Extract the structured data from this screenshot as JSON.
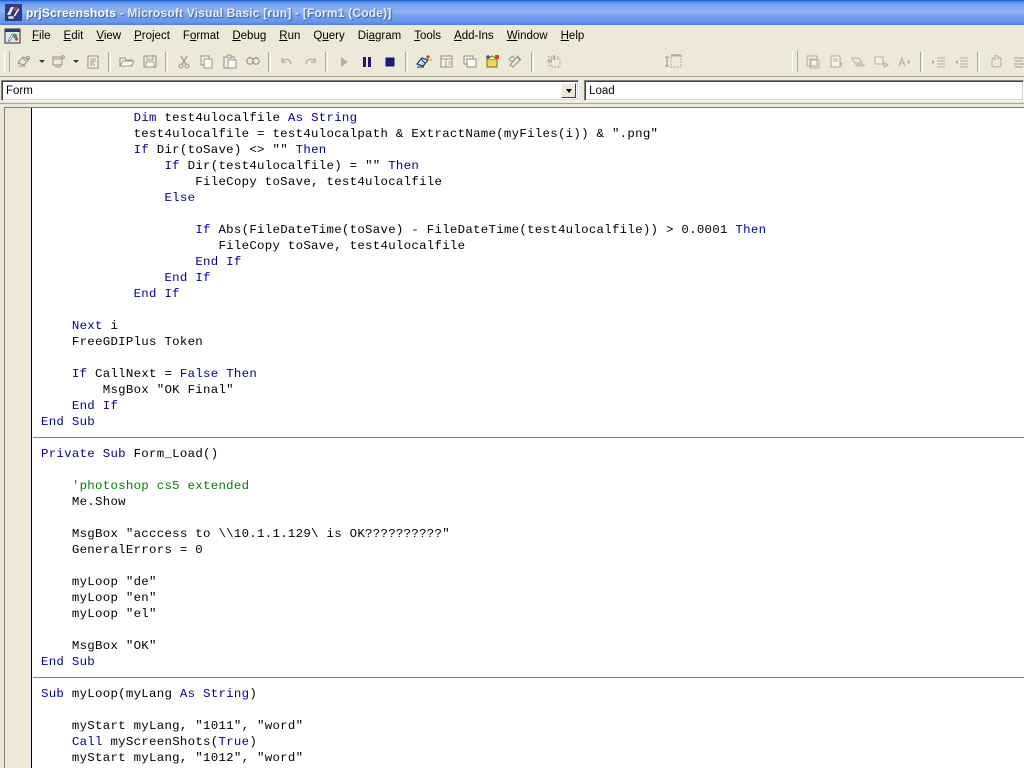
{
  "window": {
    "title_project": "prjScreenshots",
    "title_rest": " - Microsoft Visual Basic [run] - [Form1 (Code)]",
    "app_icon": "vb-project-icon",
    "system_icon": "vb-form-icon"
  },
  "menubar": {
    "items": [
      {
        "label": "File",
        "accel": "F"
      },
      {
        "label": "Edit",
        "accel": "E"
      },
      {
        "label": "View",
        "accel": "V"
      },
      {
        "label": "Project",
        "accel": "P"
      },
      {
        "label": "Format",
        "accel": "o"
      },
      {
        "label": "Debug",
        "accel": "D"
      },
      {
        "label": "Run",
        "accel": "R"
      },
      {
        "label": "Query",
        "accel": "u"
      },
      {
        "label": "Diagram",
        "accel": "a"
      },
      {
        "label": "Tools",
        "accel": "T"
      },
      {
        "label": "Add-Ins",
        "accel": "A"
      },
      {
        "label": "Window",
        "accel": "W"
      },
      {
        "label": "Help",
        "accel": "H"
      }
    ]
  },
  "toolbar": {
    "buttons": [
      {
        "name": "add-standard-exe-icon",
        "enabled": false,
        "dropdown": true
      },
      {
        "name": "add-form-icon",
        "enabled": false,
        "dropdown": true
      },
      {
        "name": "menu-editor-icon",
        "enabled": false,
        "dropdown": false
      },
      {
        "name": "open-project-icon",
        "enabled": false,
        "dropdown": false
      },
      {
        "name": "save-project-icon",
        "enabled": false,
        "dropdown": false
      },
      {
        "name": "cut-icon",
        "enabled": false,
        "dropdown": false
      },
      {
        "name": "copy-icon",
        "enabled": false,
        "dropdown": false
      },
      {
        "name": "paste-icon",
        "enabled": false,
        "dropdown": false
      },
      {
        "name": "find-icon",
        "enabled": false,
        "dropdown": false
      },
      {
        "name": "undo-icon",
        "enabled": false,
        "dropdown": false
      },
      {
        "name": "redo-icon",
        "enabled": false,
        "dropdown": false
      },
      {
        "name": "start-run-icon",
        "enabled": false,
        "dropdown": false
      },
      {
        "name": "break-pause-icon",
        "enabled": true,
        "dropdown": false
      },
      {
        "name": "end-stop-icon",
        "enabled": true,
        "dropdown": false
      },
      {
        "name": "project-explorer-icon",
        "enabled": true,
        "dropdown": false
      },
      {
        "name": "properties-window-icon",
        "enabled": false,
        "dropdown": false
      },
      {
        "name": "form-layout-icon",
        "enabled": false,
        "dropdown": false
      },
      {
        "name": "object-browser-icon",
        "enabled": true,
        "dropdown": false
      },
      {
        "name": "toolbox-icon",
        "enabled": false,
        "dropdown": false
      },
      {
        "name": "form-position-indicator",
        "enabled": false,
        "dropdown": false
      },
      {
        "name": "form-size-indicator",
        "enabled": false,
        "dropdown": false,
        "text": ""
      }
    ],
    "right_group": [
      {
        "name": "data-view-window-icon",
        "enabled": false
      },
      {
        "name": "visual-component-mgr-icon",
        "enabled": false
      },
      {
        "name": "sql-query-builder-icon",
        "enabled": false
      },
      {
        "name": "database-designer-icon",
        "enabled": false
      },
      {
        "name": "font-size-icon",
        "enabled": false
      },
      {
        "name": "indent-increase-icon",
        "enabled": false
      },
      {
        "name": "indent-decrease-icon",
        "enabled": false
      },
      {
        "name": "hand-pan-icon",
        "enabled": false
      },
      {
        "name": "align-list-icon",
        "enabled": false
      },
      {
        "name": "center-list-icon",
        "enabled": false
      }
    ]
  },
  "code_editor": {
    "object_combo": {
      "value": "Form"
    },
    "procedure_combo": {
      "value": "Load"
    },
    "lines": [
      {
        "segments": [
          {
            "t": "            ",
            "c": "pl"
          },
          {
            "t": "Dim",
            "c": "kw"
          },
          {
            "t": " test4ulocalfile ",
            "c": "pl"
          },
          {
            "t": "As String",
            "c": "kw"
          }
        ]
      },
      {
        "segments": [
          {
            "t": "            test4ulocalfile = test4ulocalpath & ExtractName(myFiles(i)) & \".png\"",
            "c": "pl"
          }
        ]
      },
      {
        "segments": [
          {
            "t": "            ",
            "c": "pl"
          },
          {
            "t": "If",
            "c": "kw"
          },
          {
            "t": " Dir(toSave) <> \"\" ",
            "c": "pl"
          },
          {
            "t": "Then",
            "c": "kw"
          }
        ]
      },
      {
        "segments": [
          {
            "t": "                ",
            "c": "pl"
          },
          {
            "t": "If",
            "c": "kw"
          },
          {
            "t": " Dir(test4ulocalfile) = \"\" ",
            "c": "pl"
          },
          {
            "t": "Then",
            "c": "kw"
          }
        ]
      },
      {
        "segments": [
          {
            "t": "                    FileCopy toSave, test4ulocalfile",
            "c": "pl"
          }
        ]
      },
      {
        "segments": [
          {
            "t": "                ",
            "c": "pl"
          },
          {
            "t": "Else",
            "c": "kw"
          }
        ]
      },
      {
        "segments": [
          {
            "t": "",
            "c": "pl"
          }
        ]
      },
      {
        "segments": [
          {
            "t": "                    ",
            "c": "pl"
          },
          {
            "t": "If",
            "c": "kw"
          },
          {
            "t": " Abs(FileDateTime(toSave) - FileDateTime(test4ulocalfile)) > 0.0001 ",
            "c": "pl"
          },
          {
            "t": "Then",
            "c": "kw"
          }
        ]
      },
      {
        "segments": [
          {
            "t": "                       FileCopy toSave, test4ulocalfile",
            "c": "pl"
          }
        ]
      },
      {
        "segments": [
          {
            "t": "                    ",
            "c": "pl"
          },
          {
            "t": "End If",
            "c": "kw"
          }
        ]
      },
      {
        "segments": [
          {
            "t": "                ",
            "c": "pl"
          },
          {
            "t": "End If",
            "c": "kw"
          }
        ]
      },
      {
        "segments": [
          {
            "t": "            ",
            "c": "pl"
          },
          {
            "t": "End If",
            "c": "kw"
          }
        ]
      },
      {
        "segments": [
          {
            "t": "",
            "c": "pl"
          }
        ]
      },
      {
        "segments": [
          {
            "t": "    ",
            "c": "pl"
          },
          {
            "t": "Next",
            "c": "kw"
          },
          {
            "t": " i",
            "c": "pl"
          }
        ]
      },
      {
        "segments": [
          {
            "t": "    FreeGDIPlus Token",
            "c": "pl"
          }
        ]
      },
      {
        "segments": [
          {
            "t": "",
            "c": "pl"
          }
        ]
      },
      {
        "segments": [
          {
            "t": "    ",
            "c": "pl"
          },
          {
            "t": "If",
            "c": "kw"
          },
          {
            "t": " CallNext = ",
            "c": "pl"
          },
          {
            "t": "False Then",
            "c": "kw"
          }
        ]
      },
      {
        "segments": [
          {
            "t": "        MsgBox \"OK Final\"",
            "c": "pl"
          }
        ]
      },
      {
        "segments": [
          {
            "t": "    ",
            "c": "pl"
          },
          {
            "t": "End If",
            "c": "kw"
          }
        ]
      },
      {
        "segments": [
          {
            "t": "",
            "c": "pl"
          },
          {
            "t": "End Sub",
            "c": "kw"
          }
        ]
      },
      {
        "separator": true,
        "segments": [
          {
            "t": "",
            "c": "pl"
          }
        ]
      },
      {
        "segments": [
          {
            "t": "",
            "c": "pl"
          },
          {
            "t": "Private Sub",
            "c": "kw"
          },
          {
            "t": " Form_Load()",
            "c": "pl"
          }
        ]
      },
      {
        "segments": [
          {
            "t": "",
            "c": "pl"
          }
        ]
      },
      {
        "segments": [
          {
            "t": "    'photoshop cs5 extended",
            "c": "cmt"
          }
        ]
      },
      {
        "segments": [
          {
            "t": "    Me.Show",
            "c": "pl"
          }
        ]
      },
      {
        "segments": [
          {
            "t": "",
            "c": "pl"
          }
        ]
      },
      {
        "segments": [
          {
            "t": "    MsgBox \"acccess to \\\\10.1.1.129\\ is OK??????????\"",
            "c": "pl"
          }
        ]
      },
      {
        "segments": [
          {
            "t": "    GeneralErrors = 0",
            "c": "pl"
          }
        ]
      },
      {
        "segments": [
          {
            "t": "",
            "c": "pl"
          }
        ]
      },
      {
        "segments": [
          {
            "t": "    myLoop \"de\"",
            "c": "pl"
          }
        ]
      },
      {
        "segments": [
          {
            "t": "    myLoop \"en\"",
            "c": "pl"
          }
        ]
      },
      {
        "segments": [
          {
            "t": "    myLoop \"el\"",
            "c": "pl"
          }
        ]
      },
      {
        "segments": [
          {
            "t": "",
            "c": "pl"
          }
        ]
      },
      {
        "segments": [
          {
            "t": "    MsgBox \"OK\"",
            "c": "pl"
          }
        ]
      },
      {
        "segments": [
          {
            "t": "",
            "c": "pl"
          },
          {
            "t": "End Sub",
            "c": "kw"
          }
        ]
      },
      {
        "separator": true,
        "segments": [
          {
            "t": "",
            "c": "pl"
          }
        ]
      },
      {
        "segments": [
          {
            "t": "",
            "c": "pl"
          },
          {
            "t": "Sub",
            "c": "kw"
          },
          {
            "t": " myLoop(myLang ",
            "c": "pl"
          },
          {
            "t": "As String",
            "c": "kw"
          },
          {
            "t": ")",
            "c": "pl"
          }
        ]
      },
      {
        "segments": [
          {
            "t": "",
            "c": "pl"
          }
        ]
      },
      {
        "segments": [
          {
            "t": "    myStart myLang, \"1011\", \"word\"",
            "c": "pl"
          }
        ]
      },
      {
        "segments": [
          {
            "t": "    ",
            "c": "pl"
          },
          {
            "t": "Call",
            "c": "kw"
          },
          {
            "t": " myScreenShots(",
            "c": "pl"
          },
          {
            "t": "True",
            "c": "kw"
          },
          {
            "t": ")",
            "c": "pl"
          }
        ]
      },
      {
        "segments": [
          {
            "t": "    myStart myLang, \"1012\", \"word\"",
            "c": "pl"
          }
        ]
      }
    ]
  },
  "colors": {
    "titlebar_blue": "#7ea6ee",
    "chrome_beige": "#ece9d8",
    "keyword_blue": "#0000a0",
    "comment_green": "#008000",
    "code_background": "#ffffff",
    "margin_beige": "#ece9d8"
  }
}
